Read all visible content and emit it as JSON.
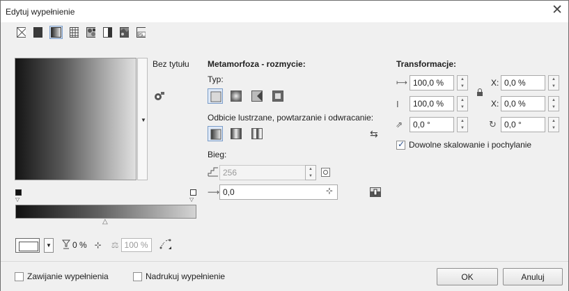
{
  "window": {
    "title": "Edytuj wypełnienie",
    "close_icon": "close-icon"
  },
  "fill_types": [
    {
      "name": "no-fill-icon",
      "selected": false
    },
    {
      "name": "uniform-fill-icon",
      "selected": false
    },
    {
      "name": "fountain-fill-icon",
      "selected": true
    },
    {
      "name": "vector-pattern-fill-icon",
      "selected": false
    },
    {
      "name": "bitmap-pattern-fill-icon",
      "selected": false
    },
    {
      "name": "two-color-pattern-fill-icon",
      "selected": false
    },
    {
      "name": "texture-fill-icon",
      "selected": false
    },
    {
      "name": "postscript-fill-icon",
      "selected": false
    }
  ],
  "left": {
    "preset_name": "Bez tytułu",
    "opacity_value": "0 %",
    "mid_value": "100 %"
  },
  "blend": {
    "section_title": "Metamorfoza - rozmycie:",
    "type_label": "Typ:",
    "mirror_label": "Odbicie lustrzane, powtarzanie i odwracanie:",
    "steps_label": "Bieg:",
    "steps_value": "256",
    "acceleration_value": "0,0"
  },
  "transform": {
    "section_title": "Transformacje:",
    "width_value": "100,0 %",
    "height_value": "100,0 %",
    "x_label": "X:",
    "x_value": "0,0 %",
    "y_label": "X:",
    "y_value": "0,0 %",
    "skew_value": "0,0 °",
    "rotate_value": "0,0 °",
    "free_scale_label": "Dowolne skalowanie i pochylanie",
    "free_scale_checked": true
  },
  "footer": {
    "wrap_label": "Zawijanie wypełnienia",
    "overprint_label": "Nadrukuj wypełnienie",
    "ok_label": "OK",
    "cancel_label": "Anuluj"
  },
  "colors": {
    "accent": "#2a4f8a",
    "selected_bg": "#dfe9f7"
  }
}
